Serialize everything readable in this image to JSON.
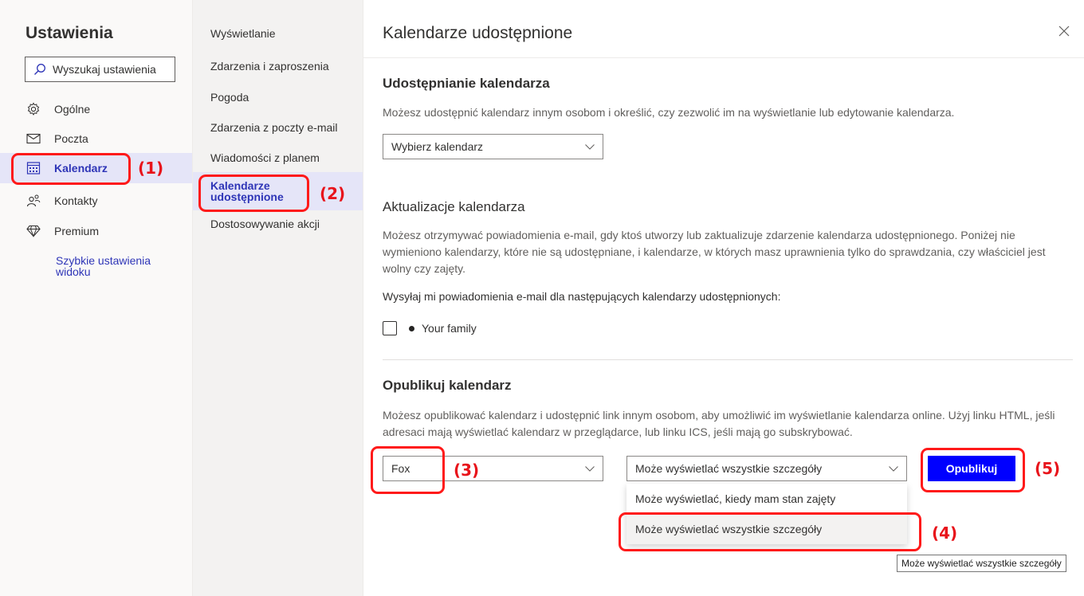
{
  "settings": {
    "title": "Ustawienia",
    "search_placeholder": "Wyszukaj ustawienia",
    "nav": [
      {
        "label": "Ogólne",
        "icon": "gear-icon"
      },
      {
        "label": "Poczta",
        "icon": "mail-icon"
      },
      {
        "label": "Kalendarz",
        "icon": "calendar-icon",
        "selected": true
      },
      {
        "label": "Kontakty",
        "icon": "people-icon"
      },
      {
        "label": "Premium",
        "icon": "diamond-icon"
      }
    ],
    "quick_settings_link": "Szybkie ustawienia widoku"
  },
  "calendar_menu": {
    "items": [
      {
        "label": "Wyświetlanie"
      },
      {
        "label": "Zdarzenia i zaproszenia"
      },
      {
        "label": "Pogoda"
      },
      {
        "label": "Zdarzenia z poczty e-mail"
      },
      {
        "label": "Wiadomości z planem"
      },
      {
        "label": "Kalendarze udostępnione",
        "selected": true
      },
      {
        "label": "Dostosowywanie akcji"
      }
    ]
  },
  "panel": {
    "title": "Kalendarze udostępnione",
    "close_icon": "close-icon",
    "sharing": {
      "heading": "Udostępnianie kalendarza",
      "description": "Możesz udostępnić kalendarz innym osobom i określić, czy zezwolić im na wyświetlanie lub edytowanie kalendarza.",
      "select_placeholder": "Wybierz kalendarz"
    },
    "updates": {
      "heading": "Aktualizacje kalendarza",
      "description": "Możesz otrzymywać powiadomienia e-mail, gdy ktoś utworzy lub zaktualizuje zdarzenie kalendarza udostępnionego. Poniżej nie wymieniono kalendarzy, które nie są udostępniane, i kalendarze, w których masz uprawnienia tylko do sprawdzania, czy właściciel jest wolny czy zajęty.",
      "send_label": "Wysyłaj mi powiadomienia e-mail dla następujących kalendarzy udostępnionych:",
      "calendars": [
        {
          "name": "Your family",
          "checked": false
        }
      ]
    },
    "publish": {
      "heading": "Opublikuj kalendarz",
      "description": "Możesz opublikować kalendarz i udostępnić link innym osobom, aby umożliwić im wyświetlanie kalendarza online. Użyj linku HTML, jeśli adresaci mają wyświetlać kalendarz w przeglądarce, lub linku ICS, jeśli mają go subskrybować.",
      "calendar_value": "Fox",
      "permission_value": "Może wyświetlać wszystkie szczegóły",
      "permission_options": [
        "Może wyświetlać, kiedy mam stan zajęty",
        "Może wyświetlać wszystkie szczegóły"
      ],
      "highlighted_option_index": 1,
      "button_label": "Opublikuj"
    },
    "tooltip": "Może wyświetlać wszystkie szczegóły"
  },
  "annotations": [
    "(1)",
    "(2)",
    "(3)",
    "(4)",
    "(5)"
  ],
  "colors": {
    "accent": "#2e35b7",
    "selected_bg": "#e5e5f8",
    "publish_button": "#0000ff",
    "annotation": "#ff1a1a"
  }
}
